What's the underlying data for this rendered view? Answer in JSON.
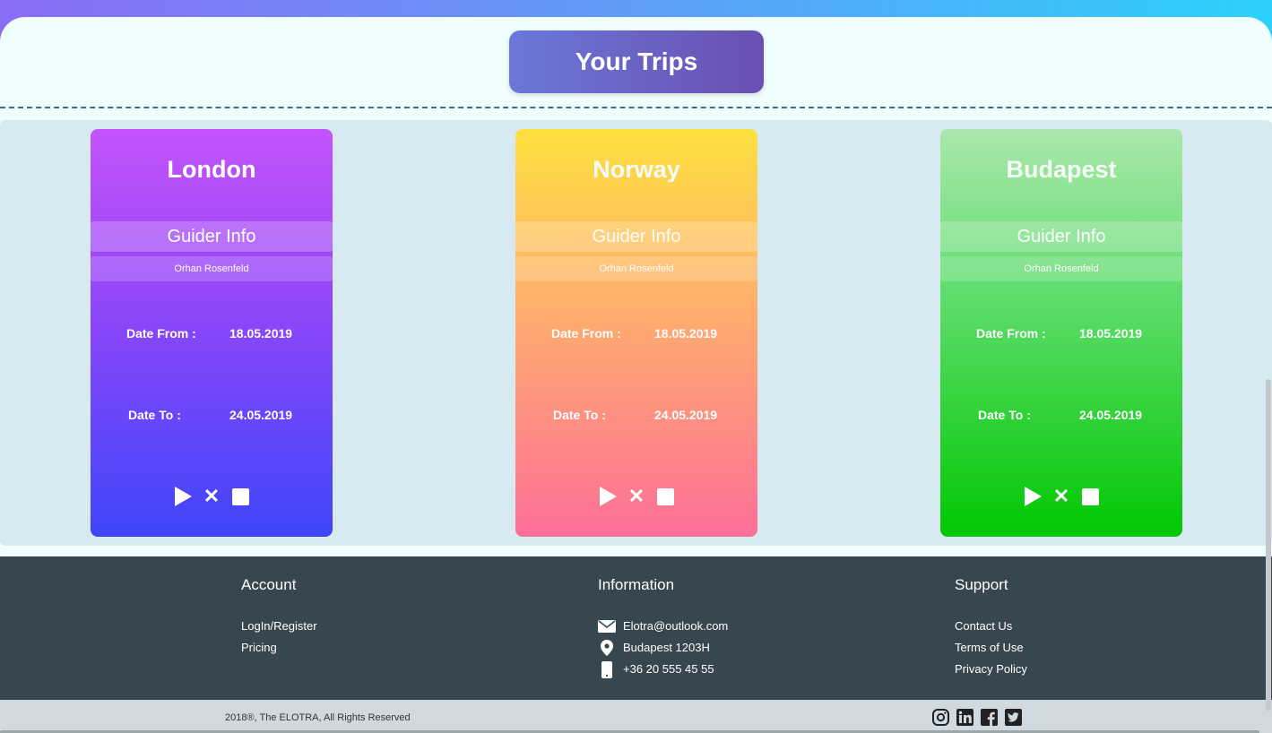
{
  "header": {
    "title": "Your Trips"
  },
  "trips": [
    {
      "city": "London",
      "guider_title": "Guider Info",
      "guider_name": "Orhan Rosenfeld",
      "date_from_label": "Date From :",
      "date_from": "18.05.2019",
      "date_to_label": "Date To :",
      "date_to": "24.05.2019"
    },
    {
      "city": "Norway",
      "guider_title": "Guider Info",
      "guider_name": "Orhan Rosenfeld",
      "date_from_label": "Date From :",
      "date_from": "18.05.2019",
      "date_to_label": "Date To :",
      "date_to": "24.05.2019"
    },
    {
      "city": "Budapest",
      "guider_title": "Guider Info",
      "guider_name": "Orhan Rosenfeld",
      "date_from_label": "Date From :",
      "date_from": "18.05.2019",
      "date_to_label": "Date To :",
      "date_to": "24.05.2019"
    }
  ],
  "footer": {
    "account": {
      "title": "Account",
      "links": [
        "LogIn/Register",
        "Pricing"
      ]
    },
    "information": {
      "title": "Information",
      "email": "Elotra@outlook.com",
      "address": "Budapest 1203H",
      "phone": "+36 20 555 45 55"
    },
    "support": {
      "title": "Support",
      "links": [
        "Contact Us",
        "Terms of Use",
        "Privacy Policy"
      ]
    }
  },
  "bottom": {
    "copyright": "2018®, The ELOTRA, All Rights Reserved",
    "socials": [
      "instagram-icon",
      "linkedin-icon",
      "facebook-icon",
      "twitter-icon"
    ]
  },
  "colors": {
    "footer_bg": "#36474f",
    "cards_bg": "#d7eaf2",
    "title_btn": "#6a64c4"
  }
}
